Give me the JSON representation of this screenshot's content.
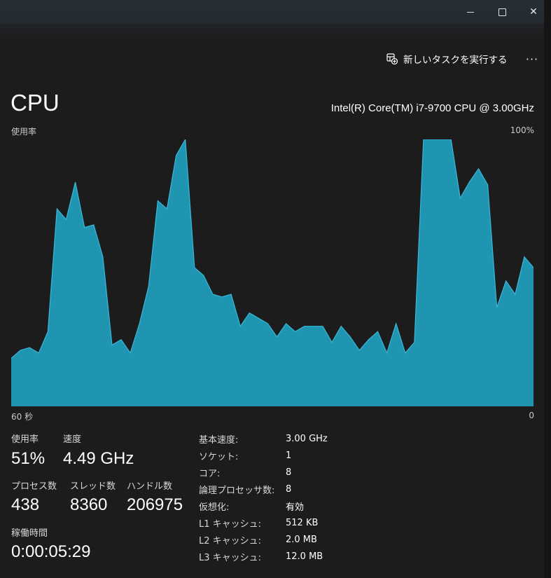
{
  "window": {
    "controls": {
      "minimize": "minimize",
      "maximize": "maximize",
      "close": "✕"
    }
  },
  "toolbar": {
    "new_task_label": "新しいタスクを実行する",
    "more_label": "···"
  },
  "header": {
    "title": "CPU",
    "cpu_model": "Intel(R) Core(TM) i7-9700 CPU @ 3.00GHz"
  },
  "graph": {
    "y_label": "使用率",
    "y_max_label": "100%",
    "x_left_label": "60 秒",
    "x_right_label": "0",
    "fill_color": "#1f9fbf",
    "line_color": "#3ab7d6"
  },
  "chart_data": {
    "type": "area",
    "xlim": [
      60,
      0
    ],
    "ylim": [
      0,
      100
    ],
    "x": [
      60,
      59,
      58,
      57,
      56,
      55,
      54,
      53,
      52,
      51,
      50,
      49,
      48,
      47,
      46,
      45,
      44,
      43,
      42,
      41,
      40,
      39,
      38,
      37,
      36,
      35,
      34,
      33,
      32,
      31,
      30,
      29,
      28,
      27,
      26,
      25,
      24,
      23,
      22,
      21,
      20,
      19,
      18,
      17,
      16,
      15,
      14,
      13,
      12,
      11,
      10,
      9,
      8,
      7,
      6,
      5,
      4,
      3,
      2,
      1,
      0
    ],
    "values": [
      18,
      21,
      22,
      20,
      28,
      74,
      70,
      84,
      67,
      68,
      56,
      23,
      25,
      20,
      31,
      45,
      77,
      74,
      94,
      100,
      52,
      49,
      42,
      41,
      42,
      30,
      35,
      33,
      31,
      26,
      31,
      28,
      30,
      30,
      30,
      24,
      30,
      26,
      21,
      25,
      28,
      20,
      31,
      20,
      24,
      100,
      100,
      100,
      100,
      78,
      84,
      89,
      83,
      37,
      47,
      42,
      56,
      52
    ]
  },
  "stats": {
    "usage_label": "使用率",
    "usage_value": "51%",
    "speed_label": "速度",
    "speed_value": "4.49 GHz",
    "processes_label": "プロセス数",
    "processes_value": "438",
    "threads_label": "スレッド数",
    "threads_value": "8360",
    "handles_label": "ハンドル数",
    "handles_value": "206975",
    "uptime_label": "稼働時間",
    "uptime_value": "0:00:05:29"
  },
  "specs": [
    {
      "key": "基本速度:",
      "value": "3.00 GHz"
    },
    {
      "key": "ソケット:",
      "value": "1"
    },
    {
      "key": "コア:",
      "value": "8"
    },
    {
      "key": "論理プロセッサ数:",
      "value": "8"
    },
    {
      "key": "仮想化:",
      "value": "有効"
    },
    {
      "key": "L1 キャッシュ:",
      "value": "512 KB"
    },
    {
      "key": "L2 キャッシュ:",
      "value": "2.0 MB"
    },
    {
      "key": "L3 キャッシュ:",
      "value": "12.0 MB"
    }
  ]
}
